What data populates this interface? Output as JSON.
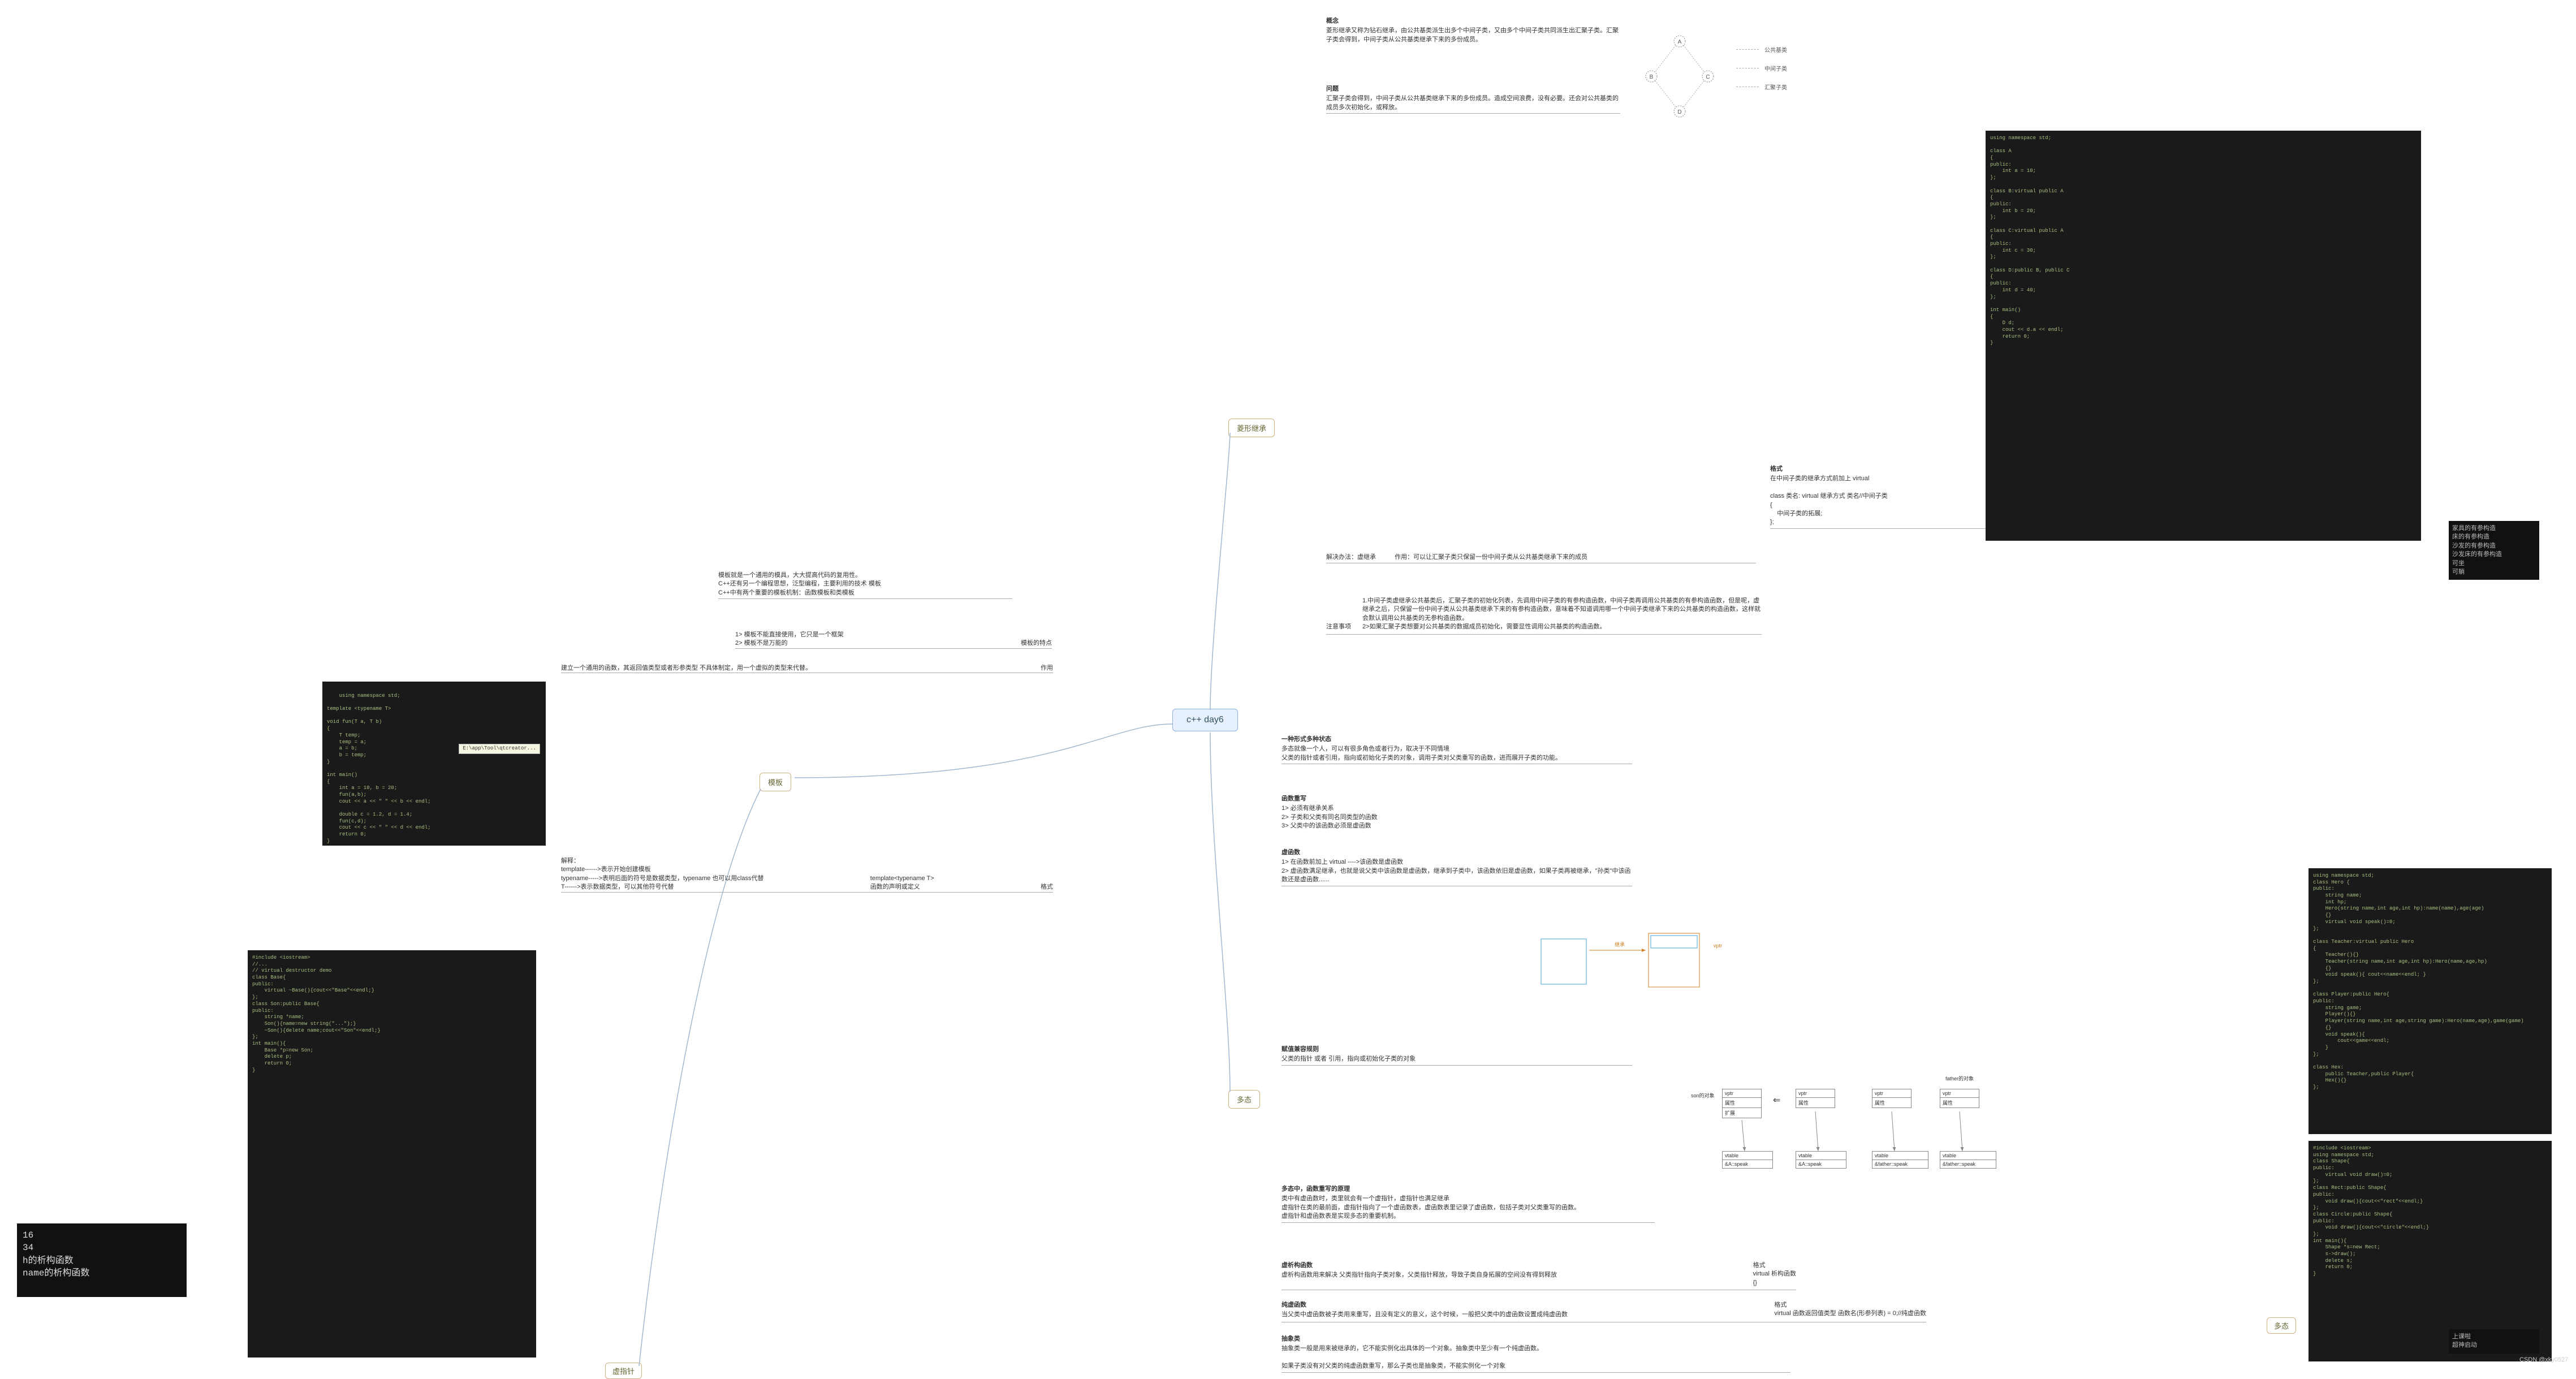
{
  "root": "c++ day6",
  "branches": {
    "diamond": "菱形继承",
    "template": "模板",
    "poly": "多态",
    "vptr": "虚指针"
  },
  "diamond": {
    "concept_h": "概念",
    "concept": "菱形继承又称为钻石继承，由公共基类派生出多个中间子类，又由多个中间子类共同派生出汇聚子类。汇聚子类会得到，中间子类从公共基类继承下来的多份成员。",
    "problem_h": "问题",
    "problem": "汇聚子类会得到，中间子类从公共基类继承下来的多份成员。造成空间浪费，没有必要。还会对公共基类的成员多次初始化，或释放。",
    "legend_a": "公共基类",
    "legend_b": "中间子类",
    "legend_c": "汇聚子类",
    "solve_h": "解决办法：虚继承",
    "solve_use": "作用：可以让汇聚子类只保留一份中间子类从公共基类继承下来的成员",
    "format_h": "格式",
    "format_body": "在中间子类的继承方式前加上 virtual\n\nclass 类名: virtual 继承方式 类名//中间子类\n{\n    中间子类的拓展;\n};",
    "note_h": "注意事项",
    "note_body": "1.中间子类虚继承公共基类后，汇聚子类的初始化列表，先调用中间子类的有参构造函数，中间子类再调用公共基类的有参构造函数，但是呢，虚继承之后，只保留一份中间子类从公共基类继承下来的有参构造函数，意味着不知道调用哪一个中间子类继承下来的公共基类的构造函数，这样就会默认调用公共基类的无参构造函数。\n2>如果汇聚子类想要对公共基类的数据成员初始化，需要显性调用公共基类的构造函数。"
  },
  "template": {
    "intro": "模板就是一个通用的模具，大大提高代码的复用性。\nC++还有另一个编程思想，泛型编程，主要利用的技术 模板\nC++中有两个重要的模板机制：函数模板和类模板",
    "feature1": "1> 模板不能直接使用，它只是一个框架",
    "feature2": "2> 模板不是万能的",
    "feature_lbl": "模板的特点",
    "use": "建立一个通用的函数，其返回值类型或者形参类型 不具体制定，用一个虚拟的类型来代替。",
    "use_lbl": "作用",
    "expl1": "解释：",
    "expl2": "template------>表示开始创建模板",
    "expl3": "typename----->表明后面的符号是数据类型，typename 也可以用class代替",
    "expl4": "T------>表示数据类型，可以其他符号代替",
    "fmt_code": "template<typename T>\n函数的声明或定义",
    "fmt_lbl": "格式"
  },
  "poly": {
    "intro_h": "一种形式多种状态",
    "intro": "多态就像一个人，可以有很多角色或者行为，取决于不同情境\n父类的指针或者引用，指向或初始化子类的对象，调用子类对父类重写的函数，进而展开子类的功能。",
    "override_h": "函数重写",
    "override_body": "1> 必须有继承关系\n2> 子类和父类有同名同类型的函数\n3> 父类中的该函数必须是虚函数",
    "vfunc_h": "虚函数",
    "vfunc_body": "1> 在函数前加上 virtual ---->该函数是虚函数\n2> 虚函数满足继承，也就是说父类中该函数是虚函数，继承到子类中，该函数依旧是虚函数，如果子类再被继承，\"孙类\"中该函数还是虚函数......",
    "compat_h": "赋值兼容规则",
    "compat": "父类的指针 或者 引用，指向或初始化子类的对象",
    "principle_h": "多态中，函数重写的原理",
    "principle": "类中有虚函数时，类里就会有一个虚指针，虚指针也满足继承\n虚指针在类的最前面，虚指针指向了一个虚函数表，虚函数表里记录了虚函数，包括子类对父类重写的函数。\n虚指针和虚函数表是实现多态的重要机制。",
    "vdtor_h": "虚析构函数",
    "vdtor_body": "虚析构函数用来解决 父类指针指向子类对象，父类指针释放，导致子类自身拓展的空间没有得到释放",
    "vdtor_fmt_h": "格式",
    "vdtor_fmt": "virtual 析构函数\n{}",
    "pure_h": "纯虚函数",
    "pure_body": "当父类中虚函数被子类用来重写，且没有定义的意义，这个时候，一般把父类中的虚函数设置成纯虚函数",
    "pure_fmt_h": "格式",
    "pure_fmt": "virtual 函数返回值类型 函数名(形参列表) = 0;//纯虚函数",
    "abstract_h": "抽象类",
    "abstract_body": "抽象类一般是用来被继承的，它不能实例化出具体的一个对象。抽象类中至少有一个纯虚函数。\n\n如果子类没有对父类的纯虚函数重写，那么子类也是抽象类，不能实例化一个对象"
  },
  "code1": {
    "body": "using namespace std;\n\ntemplate <typename T>\n\nvoid fun(T a, T b)\n{\n    T temp;\n    temp = a;\n    a = b;\n    b = temp;\n}\n\nint main()\n{\n    int a = 10, b = 20;\n    fun(a,b);\n    cout << a << \" \" << b << endl;\n\n    double c = 1.2, d = 1.4;\n    fun(c,d);\n    cout << c << \" \" << d << endl;\n    return 0;\n}",
    "tooltip": "E:\\app\\Tool\\qtcreator..."
  },
  "code2": "using namespace std;\n\nclass A\n{\npublic:\n    int a = 10;\n};\n\nclass B:virtual public A\n{\npublic:\n    int b = 20;\n};\n\nclass C:virtual public A\n{\npublic:\n    int c = 30;\n};\n\nclass D:public B, public C\n{\npublic:\n    int d = 40;\n};\n\nint main()\n{\n    D d;\n    cout << d.a << endl;\n    return 0;\n}",
  "code3": "#include <iostream>\n//...\n// virtual destructor demo\nclass Base{\npublic:\n    virtual ~Base(){cout<<\"Base\"<<endl;}\n};\nclass Son:public Base{\npublic:\n    string *name;\n    Son(){name=new string(\"...\");}\n    ~Son(){delete name;cout<<\"Son\"<<endl;}\n};\nint main(){\n    Base *p=new Son;\n    delete p;\n    return 0;\n}",
  "code4": "#include <iostream>\nusing namespace std;\nclass Shape{\npublic:\n    virtual void draw()=0;\n};\nclass Rect:public Shape{\npublic:\n    void draw(){cout<<\"rect\"<<endl;}\n};\nclass Circle:public Shape{\npublic:\n    void draw(){cout<<\"circle\"<<endl;}\n};\nint main(){\n    Shape *s=new Rect;\n    s->draw();\n    delete s;\n    return 0;\n}",
  "code5": "using namespace std;\nclass Hero {\npublic:\n    string name;\n    int hp;\n    Hero(string name,int age,int hp):name(name),age(age)\n    {}\n    virtual void speak()=0;\n};\n\nclass Teacher:virtual public Hero\n{\n    Teacher(){}\n    Teacher(string name,int age,int hp):Hero(name,age,hp)\n    {}\n    void speak(){ cout<<name<<endl; }\n};\n\nclass Player:public Hero{\npublic:\n    string game;\n    Player(){}\n    Player(string name,int age,string game):Hero(name,age),game(game)\n    {}\n    void speak(){\n        cout<<game<<endl;\n    }\n};\n\nclass Hex:\n    public Teacher,public Player{\n    Hex(){}\n};",
  "output1": "16\n34\nh的析构函数\nname的析构函数",
  "tag1": "家具的有参构造\n床的有参构造\n沙发的有参构造\n沙发床的有参构造\n可坐\n可躺",
  "tag2": "上课啦\n超神启动",
  "sub_label_poly": "多态",
  "vptr": {
    "son_obj": "son的对象",
    "arrow": "→",
    "vptr": "vptr",
    "attr": "属性",
    "vtable": "vtable",
    "extend": "扩展",
    "speak": "&A::speak",
    "father_speak": "&father::speak",
    "father_obj": "father的对象"
  },
  "diamond_graph": {
    "A": "A",
    "B": "B",
    "C": "C",
    "D": "D"
  },
  "watermark": "CSDN @xky0527"
}
